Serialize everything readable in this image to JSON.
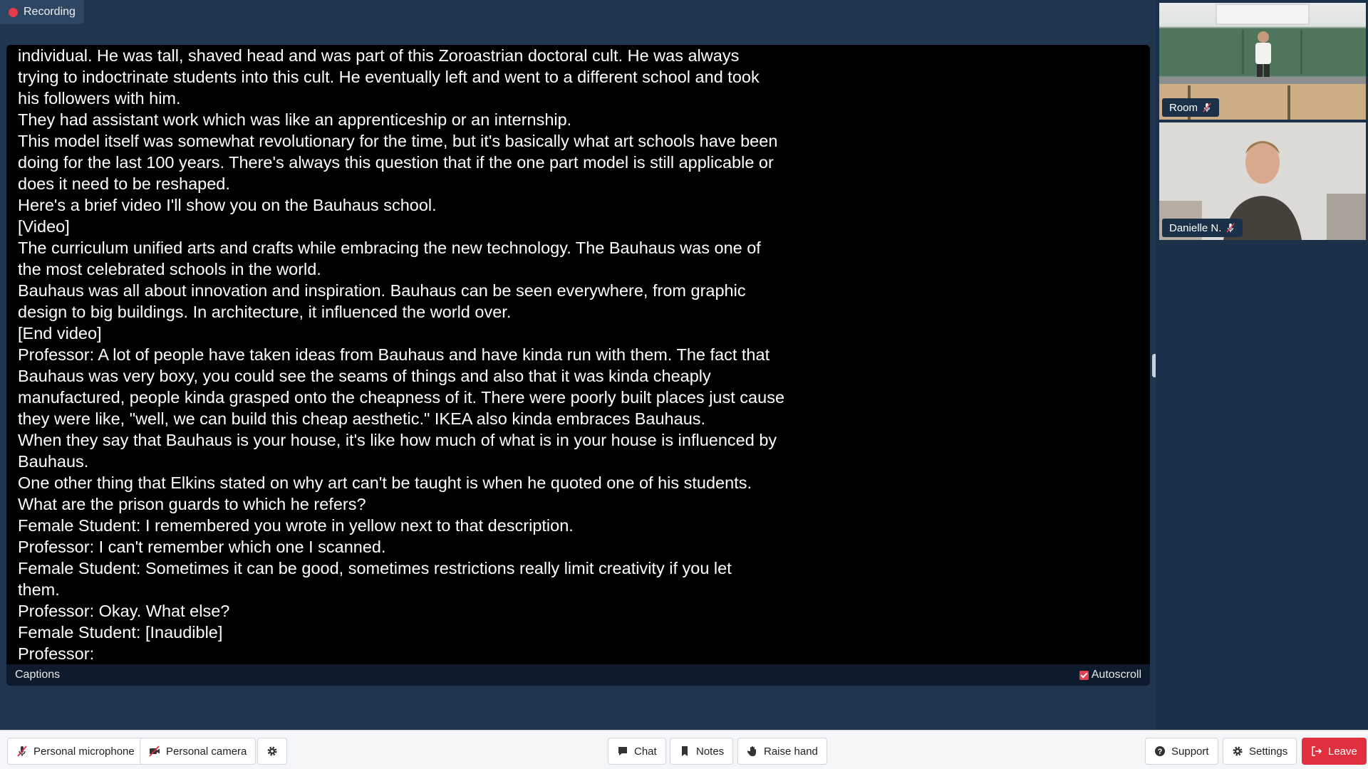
{
  "recording": {
    "label": "Recording",
    "color": "#e33b4a"
  },
  "captions": {
    "lines": [
      "individual. He was tall, shaved head and was part of this Zoroastrian doctoral cult. He was always",
      "trying to indoctrinate students into this cult. He eventually left and went to a different school and took",
      "his followers with him.",
      "They had assistant work which was like an apprenticeship or an internship.",
      "This model itself was somewhat revolutionary for the time, but it's basically what art schools have been",
      "doing for the last 100 years. There's always this question that if the one part model is still applicable or",
      "does it need to be reshaped.",
      "Here's a brief video I'll show you on the Bauhaus school.",
      "[Video]",
      "The curriculum unified arts and crafts while embracing the new technology. The Bauhaus was one of",
      "the most celebrated schools in the world.",
      "Bauhaus was all about innovation and inspiration. Bauhaus can be seen everywhere, from graphic",
      "design to big buildings. In architecture, it influenced the world over.",
      "[End video]",
      "Professor: A lot of people have taken ideas from Bauhaus and have kinda run with them. The fact that",
      "Bauhaus was very boxy, you could see the seams of things and also that it was kinda cheaply",
      "manufactured, people kinda grasped onto the cheapness of it. There were poorly built places just cause",
      "they were like, \"well, we can build this cheap aesthetic.\" IKEA also kinda embraces Bauhaus.",
      "When they say that Bauhaus is your house, it's like how much of what is in your house is influenced by",
      "Bauhaus.",
      "One other thing that Elkins stated on why art can't be taught is when he quoted one of his students.",
      "What are the prison guards to which he refers?",
      "Female Student: I remembered you wrote in yellow next to that description.",
      "Professor: I can't remember which one I scanned.",
      "Female Student: Sometimes it can be good, sometimes restrictions really limit creativity if you let",
      "them.",
      "Professor: Okay. What else?",
      "Female Student: [Inaudible]",
      "Professor:"
    ],
    "footer_label": "Captions",
    "autoscroll_label": "Autoscroll",
    "autoscroll_checked": true
  },
  "participants": [
    {
      "name": "Room",
      "icon": "mic-off-icon"
    },
    {
      "name": "Danielle N.",
      "icon": "mic-off-icon"
    }
  ],
  "toolbar": {
    "mic_label": "Personal microphone",
    "camera_label": "Personal camera",
    "chat_label": "Chat",
    "notes_label": "Notes",
    "raise_hand_label": "Raise hand",
    "support_label": "Support",
    "settings_label": "Settings",
    "leave_label": "Leave"
  },
  "colors": {
    "accent_red": "#e0303f",
    "background": "#1f3550",
    "captions_bg": "#000000"
  }
}
